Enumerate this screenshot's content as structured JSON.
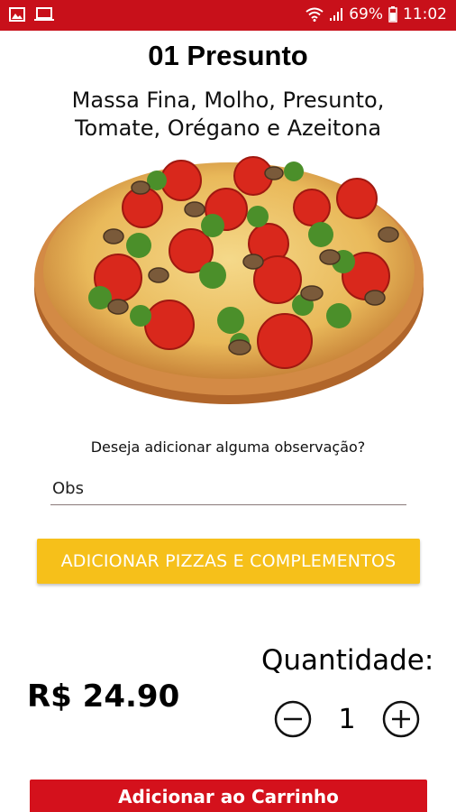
{
  "status_bar": {
    "battery": "69%",
    "time": "11:02",
    "left_icons": [
      "image-icon",
      "laptop-icon"
    ],
    "right_icons": [
      "wifi-icon",
      "signal-icon",
      "battery-icon"
    ]
  },
  "product": {
    "title": "01 Presunto",
    "description": "Massa Fina, Molho, Presunto, Tomate, Orégano e Azeitona"
  },
  "observation": {
    "question": "Deseja adicionar alguma observação?",
    "placeholder": "Obs"
  },
  "add_button_label": "ADICIONAR PIZZAS E COMPLEMENTOS",
  "price": "R$ 24.90",
  "quantity": {
    "label": "Quantidade:",
    "value": "1"
  },
  "cart_button_label": "Adicionar ao Carrinho",
  "colors": {
    "status_bar": "#c8101a",
    "accent_yellow": "#f6c01a",
    "cart_red": "#d4111c"
  }
}
